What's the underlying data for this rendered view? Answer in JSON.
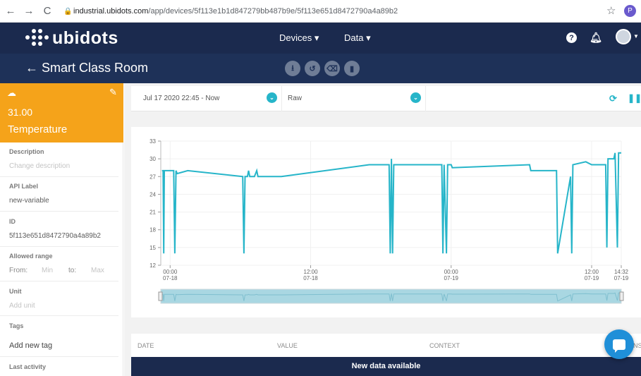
{
  "browser": {
    "url_host": "industrial.ubidots.com",
    "url_path": "/app/devices/5f113e1b1d847279bb487b9e/5f113e651d8472790a4a89b2",
    "profile_initial": "P"
  },
  "topnav": {
    "brand": "ubidots",
    "devices_label": "Devices ▾",
    "data_label": "Data ▾",
    "help_label": "?"
  },
  "subheader": {
    "title": "← Smart Class Room"
  },
  "variable": {
    "value": "31.00",
    "name": "Temperature"
  },
  "fields": {
    "description_label": "Description",
    "description_value": "Change description",
    "api_label_label": "API Label",
    "api_label_value": "new-variable",
    "id_label": "ID",
    "id_value": "5f113e651d8472790a4a89b2",
    "range_label": "Allowed range",
    "range_from": "From:",
    "range_min": "Min",
    "range_to": "to:",
    "range_max": "Max",
    "unit_label": "Unit",
    "unit_value": "Add unit",
    "tags_label": "Tags",
    "tags_value": "Add new tag",
    "last_activity_label": "Last activity"
  },
  "filters": {
    "date_range": "Jul 17 2020 22:45 - Now",
    "aggregation": "Raw"
  },
  "table": {
    "headers": [
      "DATE",
      "VALUE",
      "CONTEXT",
      "NS"
    ],
    "banner": "New data available"
  },
  "colors": {
    "accent": "#26b5c9",
    "brand_dark": "#1b2a4e",
    "variable_card": "#f5a31a"
  },
  "chart_data": {
    "type": "line",
    "title": "",
    "xlabel": "",
    "ylabel": "",
    "ylim": [
      12,
      33
    ],
    "yticks": [
      12,
      15,
      18,
      21,
      24,
      27,
      30,
      33
    ],
    "xticks": [
      {
        "t": 0.0,
        "label": [
          "00:00",
          "07-18"
        ]
      },
      {
        "t": 12.0,
        "label": [
          "12:00",
          "07-18"
        ]
      },
      {
        "t": 24.0,
        "label": [
          "00:00",
          "07-19"
        ]
      },
      {
        "t": 36.0,
        "label": [
          "12:00",
          "07-19"
        ]
      },
      {
        "t": 38.53,
        "label": [
          "14:32",
          "07-19"
        ]
      }
    ],
    "x_unit": "hours since 07-18 00:00",
    "series": [
      {
        "name": "Temperature",
        "points": [
          [
            -0.7,
            28
          ],
          [
            -0.6,
            28
          ],
          [
            -0.55,
            14
          ],
          [
            -0.5,
            28
          ],
          [
            -0.2,
            28
          ],
          [
            0.1,
            28
          ],
          [
            0.3,
            28
          ],
          [
            0.4,
            14
          ],
          [
            0.5,
            28
          ],
          [
            0.6,
            27.5
          ],
          [
            1.5,
            28
          ],
          [
            6.2,
            27
          ],
          [
            6.3,
            14
          ],
          [
            6.4,
            27
          ],
          [
            6.6,
            27
          ],
          [
            6.7,
            28
          ],
          [
            6.8,
            27
          ],
          [
            7.2,
            27
          ],
          [
            7.4,
            28
          ],
          [
            7.5,
            27
          ],
          [
            9.5,
            27
          ],
          [
            17.0,
            29
          ],
          [
            18.7,
            29
          ],
          [
            18.8,
            14
          ],
          [
            18.9,
            30
          ],
          [
            19.0,
            14
          ],
          [
            19.1,
            29
          ],
          [
            23.2,
            29
          ],
          [
            23.3,
            14
          ],
          [
            23.4,
            29
          ],
          [
            23.6,
            14
          ],
          [
            23.7,
            29
          ],
          [
            23.9,
            29
          ],
          [
            24.0,
            29
          ],
          [
            24.1,
            28.5
          ],
          [
            30.7,
            29
          ],
          [
            30.8,
            28
          ],
          [
            33.0,
            28
          ],
          [
            33.1,
            14
          ],
          [
            34.2,
            27
          ],
          [
            34.3,
            14
          ],
          [
            34.4,
            29
          ],
          [
            35.5,
            29.5
          ],
          [
            36.0,
            29
          ],
          [
            37.2,
            29
          ],
          [
            37.3,
            15
          ],
          [
            37.4,
            30
          ],
          [
            37.9,
            30
          ],
          [
            38.0,
            31
          ],
          [
            38.2,
            15
          ],
          [
            38.3,
            31
          ],
          [
            38.53,
            31
          ]
        ]
      }
    ]
  }
}
